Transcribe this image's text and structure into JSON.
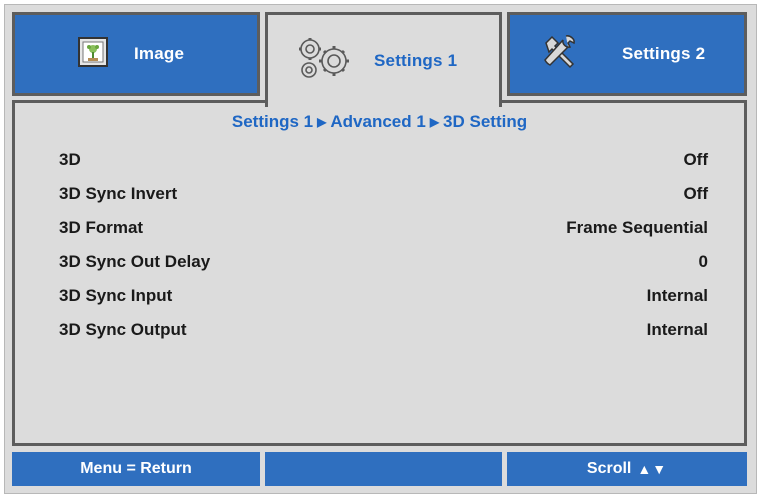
{
  "tabs": {
    "image": {
      "label": "Image",
      "icon": "image-icon"
    },
    "settings1": {
      "label": "Settings 1",
      "icon": "gears-icon",
      "active": true
    },
    "settings2": {
      "label": "Settings 2",
      "icon": "tools-icon"
    }
  },
  "breadcrumb": {
    "part1": "Settings 1",
    "part2": "Advanced 1",
    "part3": "3D Setting",
    "separator": "▶"
  },
  "rows": [
    {
      "label": "3D",
      "value": "Off"
    },
    {
      "label": "3D Sync Invert",
      "value": "Off"
    },
    {
      "label": "3D Format",
      "value": "Frame Sequential"
    },
    {
      "label": "3D Sync Out Delay",
      "value": "0"
    },
    {
      "label": "3D Sync Input",
      "value": "Internal"
    },
    {
      "label": "3D Sync Output",
      "value": "Internal"
    }
  ],
  "statusbar": {
    "left": "Menu = Return",
    "middle": "",
    "right": "Scroll",
    "right_arrows": "▲▼"
  },
  "colors": {
    "accent_blue": "#2f6fbf",
    "text_blue": "#1f67c4",
    "panel_gray": "#dcdcdc",
    "border_dark": "#5d5d5d"
  }
}
